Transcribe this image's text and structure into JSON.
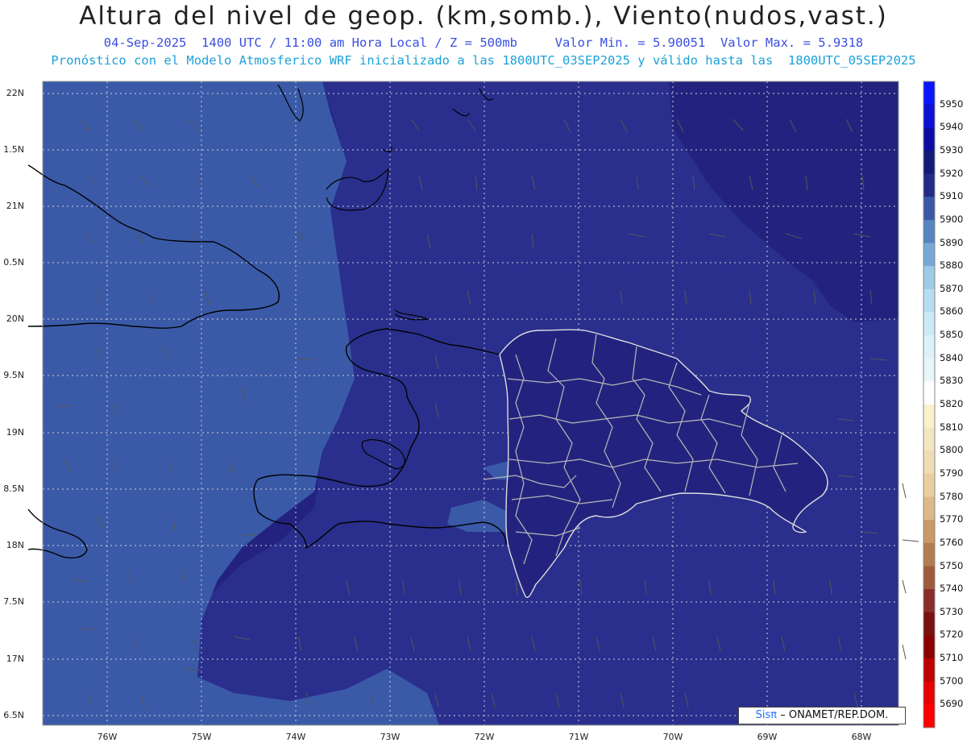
{
  "header": {
    "title": "Altura del nivel de geop. (km,somb.), Viento(nudos,vast.)",
    "line1": "04-Sep-2025  1400 UTC / 11:00 am Hora Local / Z = 500mb     Valor Min. = 5.90051  Valor Max. = 5.9318",
    "line2": "Pronóstico con el Modelo Atmosferico WRF inicializado a las 1800UTC_03SEP2025 y válido hasta las  1800UTC_05SEP2025"
  },
  "map": {
    "lat_labels": [
      "22N",
      "1.5N",
      "21N",
      "0.5N",
      "20N",
      "9.5N",
      "19N",
      "8.5N",
      "18N",
      "7.5N",
      "17N",
      "6.5N"
    ],
    "lon_labels": [
      "76W",
      "75W",
      "74W",
      "73W",
      "72W",
      "71W",
      "70W",
      "69W",
      "68W"
    ],
    "colors": {
      "deep": "#23237f",
      "mid": "#2a2f8d",
      "light": "#3a5aa8",
      "lighter": "#4f7bc0",
      "coast": "#000000",
      "border": "#b8b8b8",
      "grid": "#d8d8d8"
    }
  },
  "colorbar": {
    "levels": [
      "5950",
      "5940",
      "5930",
      "5920",
      "5910",
      "5900",
      "5890",
      "5880",
      "5870",
      "5860",
      "5850",
      "5840",
      "5830",
      "5820",
      "5810",
      "5800",
      "5790",
      "5780",
      "5770",
      "5760",
      "5750",
      "5740",
      "5730",
      "5720",
      "5710",
      "5700",
      "5690"
    ],
    "colors": [
      "#0a14ff",
      "#0b10d4",
      "#0c0ca4",
      "#141a78",
      "#232b88",
      "#3a57a6",
      "#5584c0",
      "#77a8d6",
      "#9bcbe6",
      "#b6def0",
      "#cceaf5",
      "#ddf1f8",
      "#e8f6fa",
      "#fff",
      "#faf0cc",
      "#f4e6c0",
      "#efdcb4",
      "#e9cfa0",
      "#ddb888",
      "#c99a66",
      "#b17c50",
      "#a05a3c",
      "#8a2e2a",
      "#7a1010",
      "#8a0000",
      "#c00000",
      "#e80000",
      "#ff0000"
    ]
  },
  "credit": {
    "brand": "Sisπ",
    "text": "– ONAMET/REP.DOM."
  }
}
